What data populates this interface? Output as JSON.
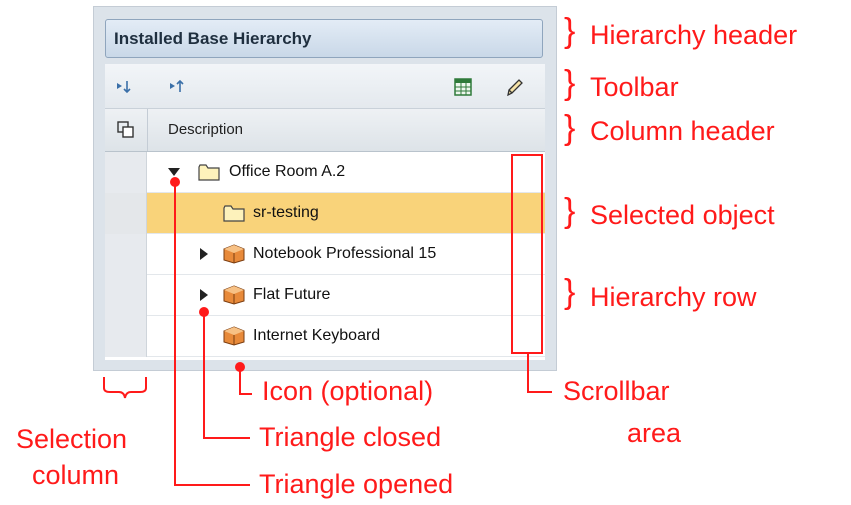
{
  "hierarchy": {
    "title": "Installed Base Hierarchy"
  },
  "toolbar": {
    "expand_all_icon": "expand-all-icon",
    "collapse_all_icon": "collapse-all-icon",
    "export_icon": "spreadsheet-icon",
    "edit_icon": "pencil-icon"
  },
  "columns": {
    "header": "Description",
    "select_all_icon": "select-all-icon"
  },
  "rows": [
    {
      "label": "Office Room A.2",
      "triangle": "open",
      "icon": "folder-icon",
      "selected": false
    },
    {
      "label": "sr-testing",
      "triangle": "none",
      "icon": "folder-icon",
      "selected": true
    },
    {
      "label": "Notebook Professional 15",
      "triangle": "closed",
      "icon": "package-icon",
      "selected": false
    },
    {
      "label": "Flat Future",
      "triangle": "closed",
      "icon": "package-icon",
      "selected": false
    },
    {
      "label": "Internet Keyboard",
      "triangle": "none",
      "icon": "package-icon",
      "selected": false
    }
  ],
  "annotations": {
    "hierarchy_header": "Hierarchy header",
    "toolbar": "Toolbar",
    "column_header": "Column header",
    "selected_object": "Selected object",
    "hierarchy_row": "Hierarchy row",
    "scrollbar_line1": "Scrollbar",
    "scrollbar_line2": "area",
    "icon_optional": "Icon (optional)",
    "triangle_closed": "Triangle closed",
    "triangle_opened": "Triangle opened",
    "selection_line1": "Selection",
    "selection_line2": "column"
  },
  "colors": {
    "annotation": "#ff1a1a",
    "selected_row": "#f9d37a",
    "header_bg": "#c9d8e8"
  }
}
